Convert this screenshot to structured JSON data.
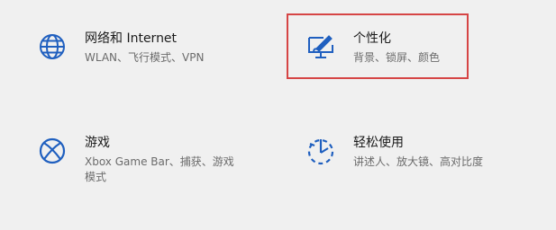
{
  "settings": {
    "accent_color": "#1f5fbf",
    "highlight_color": "#d64545",
    "tiles": [
      {
        "title": "网络和 Internet",
        "description": "WLAN、飞行模式、VPN",
        "icon": "globe-icon"
      },
      {
        "title": "个性化",
        "description": "背景、锁屏、颜色",
        "icon": "paintbrush-monitor-icon"
      },
      {
        "title": "游戏",
        "description_line1": "Xbox Game Bar、捕获、游戏",
        "description_line2": "模式",
        "icon": "xbox-icon"
      },
      {
        "title": "轻松使用",
        "description": "讲述人、放大镜、高对比度",
        "icon": "ease-of-access-icon"
      }
    ]
  }
}
